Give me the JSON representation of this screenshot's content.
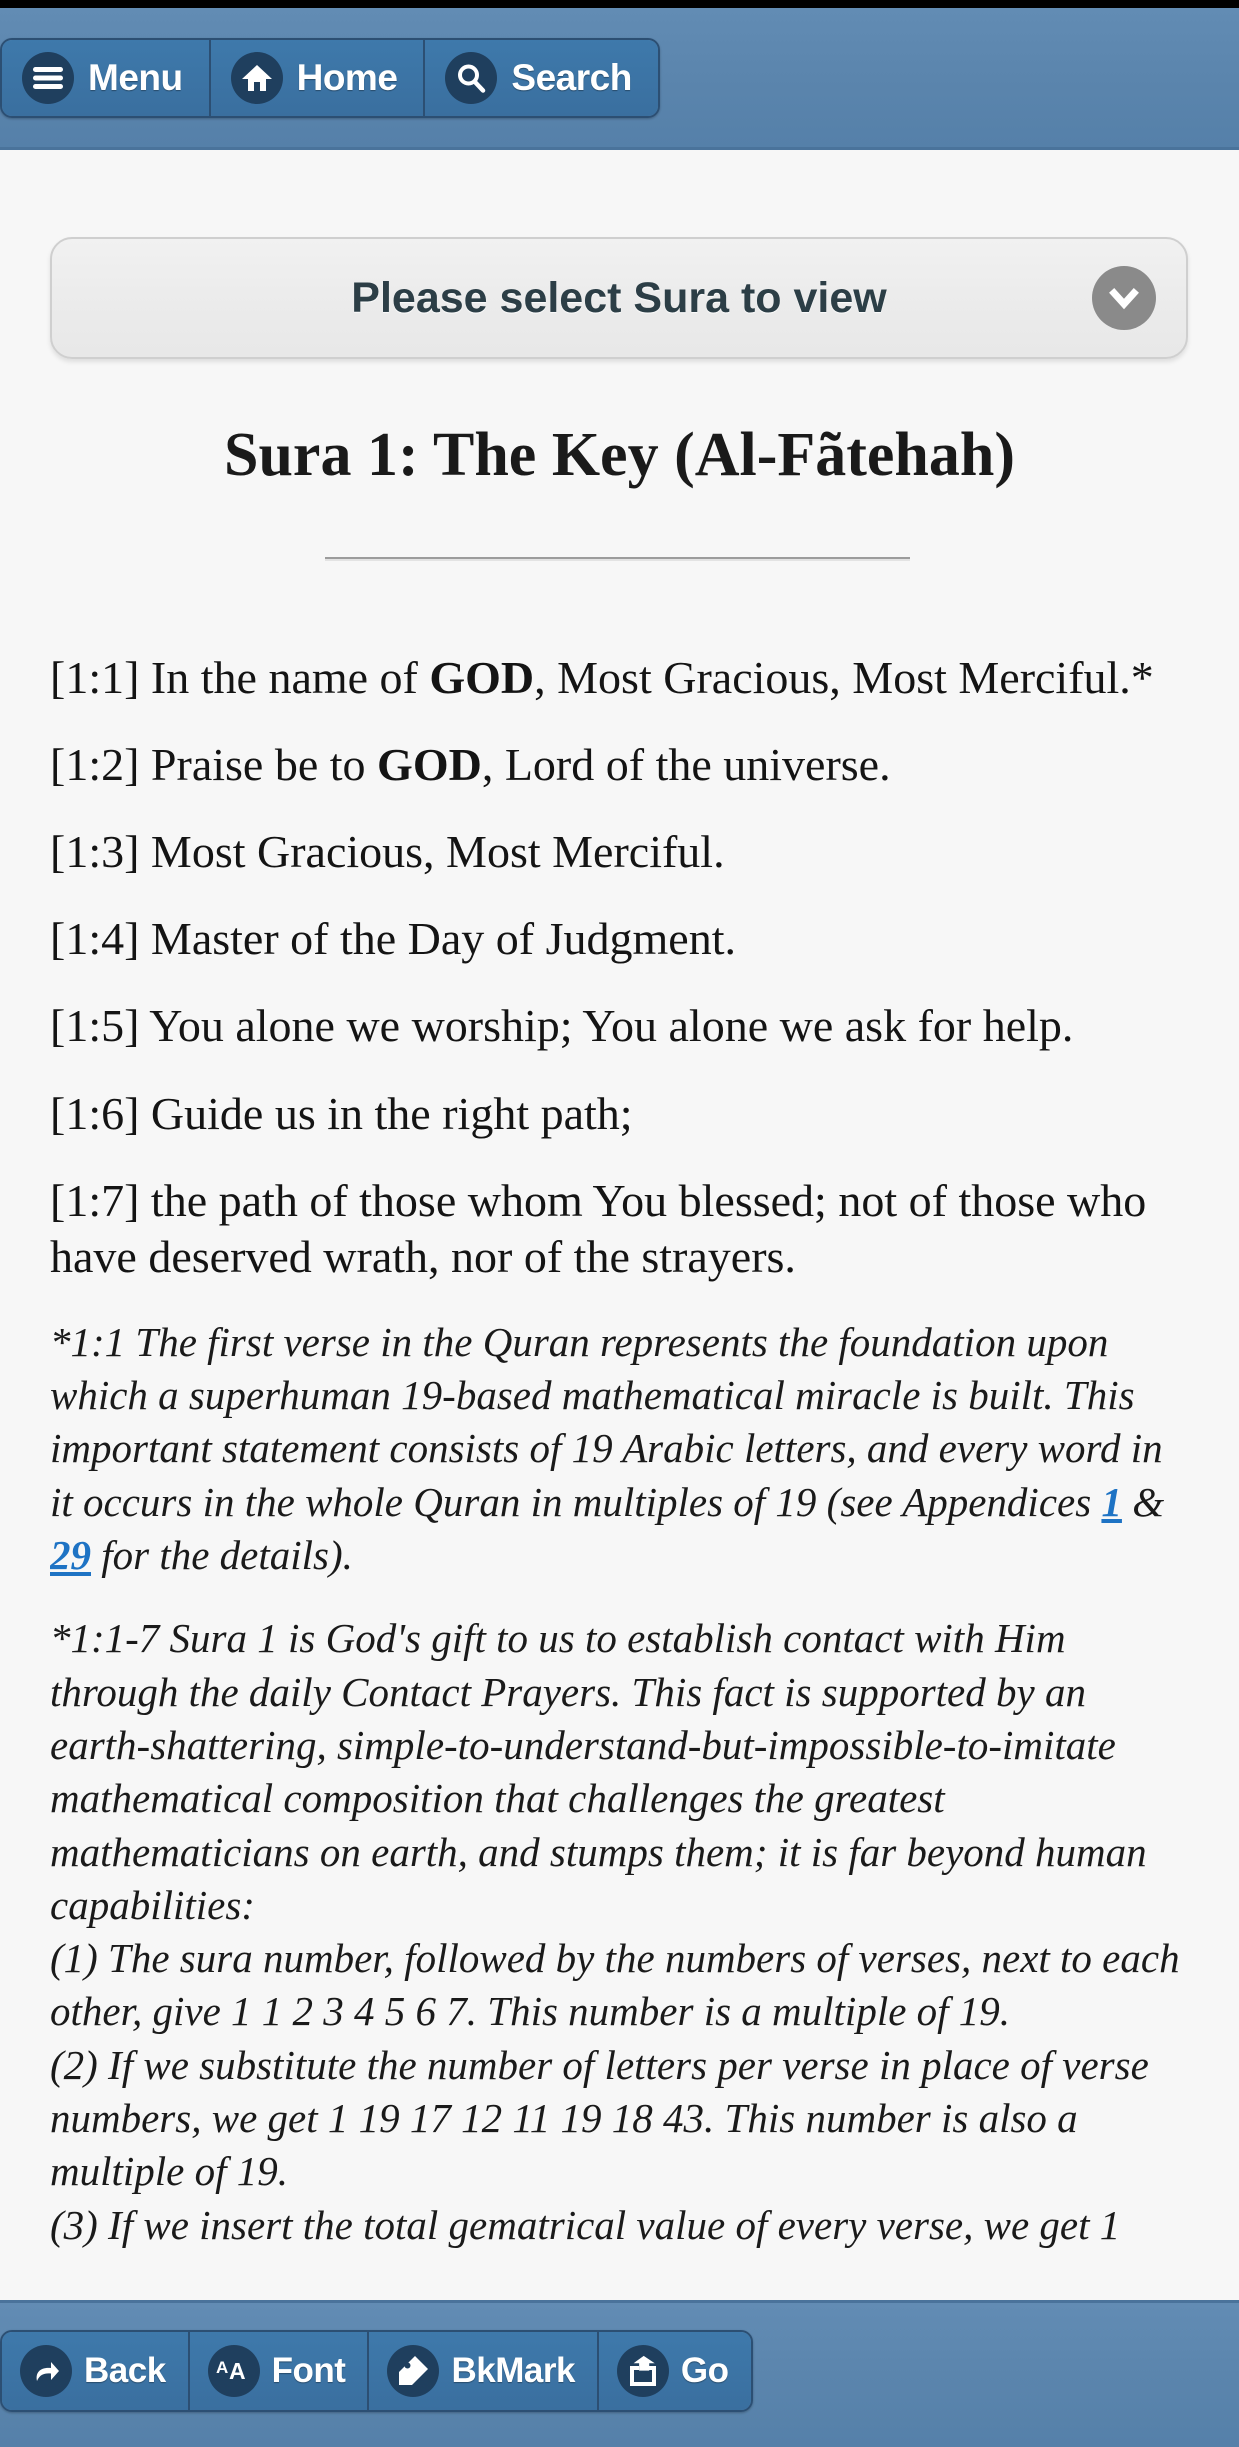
{
  "theme": {
    "navbar_blue": "#5b85ad",
    "button_blue": "#3a6f9f",
    "icon_navy": "#1f3f5e",
    "page_bg": "#f7f7f7",
    "link_blue": "#1e73c4",
    "select_arrow_gray": "#8a8a8a"
  },
  "topbar": {
    "buttons": [
      {
        "label": "Menu",
        "icon": "hamburger-menu-icon"
      },
      {
        "label": "Home",
        "icon": "home-icon"
      },
      {
        "label": "Search",
        "icon": "search-icon"
      }
    ]
  },
  "selector": {
    "label": "Please select Sura to view",
    "arrow_icon": "chevron-down-icon"
  },
  "sura": {
    "title": "Sura 1: The Key (Al-Fãtehah)",
    "verses": [
      {
        "ref": "[1:1] ",
        "pre": "In the name of ",
        "bold": "GOD",
        "post": ", Most Gracious, Most Merciful.*"
      },
      {
        "ref": "[1:2] ",
        "pre": "Praise be to ",
        "bold": "GOD",
        "post": ", Lord of the universe."
      },
      {
        "ref": "[1:3] ",
        "pre": "Most Gracious, Most Merciful.",
        "bold": "",
        "post": ""
      },
      {
        "ref": "[1:4] ",
        "pre": "Master of the Day of Judgment.",
        "bold": "",
        "post": ""
      },
      {
        "ref": "[1:5] ",
        "pre": "You alone we worship; You alone we ask for help.",
        "bold": "",
        "post": ""
      },
      {
        "ref": "[1:6] ",
        "pre": "Guide us in the right path;",
        "bold": "",
        "post": ""
      },
      {
        "ref": "[1:7] ",
        "pre": "the path of those whom You blessed; not of those who have deserved wrath, nor of the strayers.",
        "bold": "",
        "post": ""
      }
    ],
    "footnotes": [
      {
        "id": "note-1-1",
        "text_before": "*1:1 The first verse in the Quran represents the foundation upon which a superhuman 19-based mathematical miracle is built. This important statement consists of 19 Arabic letters, and every word in it occurs in the whole Quran in multiples of 19 (see Appendices ",
        "link_1": "1",
        "between_links": " & ",
        "link_2": "29",
        "text_after": " for the details)."
      },
      {
        "id": "note-1-1-7",
        "intro": "*1:1-7 Sura 1 is God's gift to us to establish contact with Him through the daily Contact Prayers. This fact is supported by an earth-shattering, simple-to-understand-but-impossible-to-imitate mathematical composition that challenges the greatest mathematicians on earth, and stumps them; it is far beyond human capabilities:",
        "points": [
          "(1) The sura number, followed by the numbers of verses, next to each other, give 1 1 2 3 4 5 6 7. This number is a multiple of 19.",
          "(2) If we substitute the number of letters per verse in place of  verse numbers, we get 1 19 17 12 11 19 18 43. This number is also a multiple of 19.",
          "(3) If we insert the total gematrical value of every verse, we get 1"
        ]
      }
    ]
  },
  "bottombar": {
    "buttons": [
      {
        "label": "Back",
        "icon": "undo-arrow-icon"
      },
      {
        "label": "Font",
        "icon": "font-size-aa-icon"
      },
      {
        "label": "BkMark",
        "icon": "tag-bookmark-icon"
      },
      {
        "label": "Go",
        "icon": "share-export-icon"
      }
    ]
  }
}
